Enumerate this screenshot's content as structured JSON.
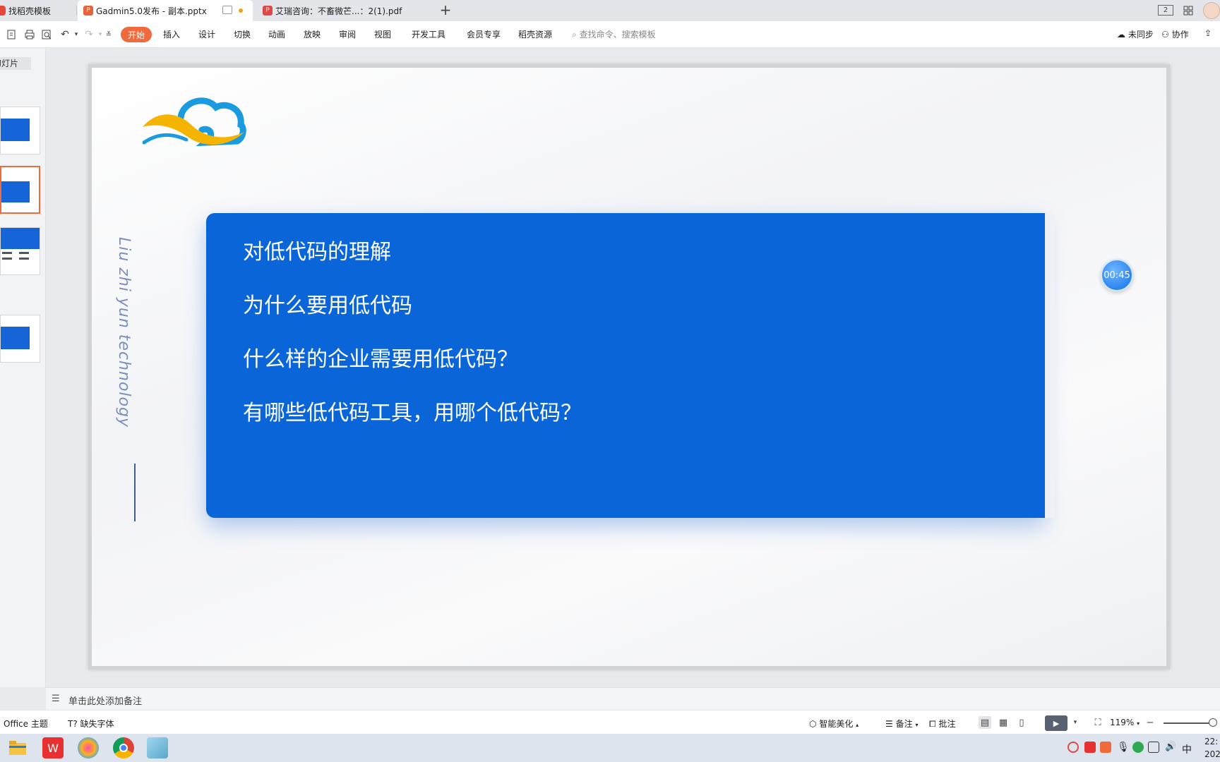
{
  "tabs": [
    {
      "label": "找稻壳模板"
    },
    {
      "label": "Gadmin5.0发布 - 副本.pptx"
    },
    {
      "label": "艾瑞咨询：不畜微芒...：2(1).pdf"
    }
  ],
  "window": {
    "page_indicator": "2"
  },
  "ribbon": {
    "menu": [
      "开始",
      "插入",
      "设计",
      "切换",
      "动画",
      "放映",
      "审阅",
      "视图",
      "开发工具",
      "会员专享",
      "稻壳资源"
    ],
    "search_placeholder": "查找命令、搜索模板",
    "sync_label": "未同步",
    "collab_label": "协作"
  },
  "left_panel": {
    "tab_label": "幻灯片"
  },
  "slide": {
    "vertical_text": "Liu zhi yun technology",
    "lines": [
      "对低代码的理解",
      "为什么要用低代码",
      "什么样的企业需要用低代码？",
      "有哪些低代码工具，用哪个低代码？"
    ],
    "accent_color": "#0a66d8",
    "timer": "00:45"
  },
  "notes": {
    "placeholder": "单击此处添加备注"
  },
  "status": {
    "theme": "Office 主题",
    "missing_font": "缺失字体",
    "beautify": "智能美化",
    "notes_btn": "备注",
    "comment_btn": "批注",
    "zoom": "119%"
  },
  "taskbar": {
    "time": "22:",
    "date": "202",
    "ime": "中"
  }
}
